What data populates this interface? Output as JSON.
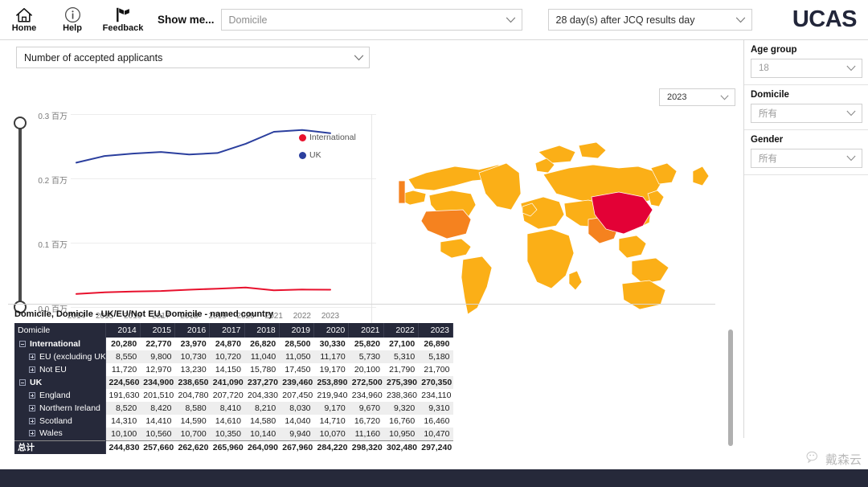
{
  "topbar": {
    "tools": [
      {
        "label": "Home",
        "icon": "home-icon"
      },
      {
        "label": "Help",
        "icon": "info-icon"
      },
      {
        "label": "Feedback",
        "icon": "feedback-flag-icon"
      }
    ],
    "show_me_label": "Show me...",
    "show_me_value": "Domicile",
    "day_selector_value": "28 day(s) after JCQ results day",
    "logo": "UCAS"
  },
  "filters": [
    {
      "title": "Age group",
      "value": "18"
    },
    {
      "title": "Domicile",
      "value": "所有"
    },
    {
      "title": "Gender",
      "value": "所有"
    }
  ],
  "chart_panel": {
    "metric_value": "Number of accepted applicants",
    "year_value": "2023"
  },
  "chart_data": {
    "type": "line",
    "title": "Number of accepted applicants",
    "xlabel": "",
    "ylabel": "",
    "grid": true,
    "legend_position": "right",
    "ylim": [
      0,
      300000
    ],
    "ytick_labels": [
      "0.3 百万",
      "0.2 百万",
      "0.1 百万",
      "0.0 百万"
    ],
    "ytick_values": [
      300000,
      200000,
      100000,
      0
    ],
    "categories": [
      "2014",
      "2015",
      "2016",
      "2017",
      "2018",
      "2019",
      "2020",
      "2021",
      "2022",
      "2023"
    ],
    "series": [
      {
        "name": "UK",
        "color": "#2b3f9e",
        "values": [
          224560,
          234900,
          238650,
          241090,
          237270,
          239460,
          253890,
          272500,
          275390,
          270350
        ]
      },
      {
        "name": "International",
        "color": "#e8112d",
        "values": [
          20280,
          22770,
          23970,
          24870,
          26820,
          28500,
          30330,
          25820,
          27100,
          26890
        ]
      }
    ]
  },
  "map": {
    "type": "choropleth",
    "highlight_country": "China",
    "colors": {
      "high": "#e30136",
      "mid": "#f5821f",
      "base": "#fbaf17"
    }
  },
  "table": {
    "caption": "Domicile, Domicile - UK/EU/Not EU, Domicile - named country",
    "first_column_header": "Domicile",
    "year_headers": [
      "2014",
      "2015",
      "2016",
      "2017",
      "2018",
      "2019",
      "2020",
      "2021",
      "2022",
      "2023"
    ],
    "rows": [
      {
        "label": "International",
        "indent": 0,
        "toggle": "minus",
        "bold": true,
        "band": false,
        "clipped": false,
        "values": [
          "20,280",
          "22,770",
          "23,970",
          "24,870",
          "26,820",
          "28,500",
          "30,330",
          "25,820",
          "27,100",
          "26,890"
        ]
      },
      {
        "label": "EU (excluding UK)",
        "indent": 1,
        "toggle": "plus",
        "bold": false,
        "band": true,
        "clipped": false,
        "values": [
          "8,550",
          "9,800",
          "10,730",
          "10,720",
          "11,040",
          "11,050",
          "11,170",
          "5,730",
          "5,310",
          "5,180"
        ]
      },
      {
        "label": "Not EU",
        "indent": 1,
        "toggle": "plus",
        "bold": false,
        "band": false,
        "clipped": false,
        "values": [
          "11,720",
          "12,970",
          "13,230",
          "14,150",
          "15,780",
          "17,450",
          "19,170",
          "20,100",
          "21,790",
          "21,700"
        ]
      },
      {
        "label": "UK",
        "indent": 0,
        "toggle": "minus",
        "bold": true,
        "band": true,
        "clipped": false,
        "values": [
          "224,560",
          "234,900",
          "238,650",
          "241,090",
          "237,270",
          "239,460",
          "253,890",
          "272,500",
          "275,390",
          "270,350"
        ]
      },
      {
        "label": "England",
        "indent": 1,
        "toggle": "plus",
        "bold": false,
        "band": false,
        "clipped": false,
        "values": [
          "191,630",
          "201,510",
          "204,780",
          "207,720",
          "204,330",
          "207,450",
          "219,940",
          "234,960",
          "238,360",
          "234,110"
        ]
      },
      {
        "label": "Northern Ireland",
        "indent": 1,
        "toggle": "plus",
        "bold": false,
        "band": true,
        "clipped": false,
        "values": [
          "8,520",
          "8,420",
          "8,580",
          "8,410",
          "8,210",
          "8,030",
          "9,170",
          "9,670",
          "9,320",
          "9,310"
        ]
      },
      {
        "label": "Scotland",
        "indent": 1,
        "toggle": "plus",
        "bold": false,
        "band": false,
        "clipped": false,
        "values": [
          "14,310",
          "14,410",
          "14,590",
          "14,610",
          "14,580",
          "14,040",
          "14,710",
          "16,720",
          "16,760",
          "16,460"
        ]
      },
      {
        "label": "Wales",
        "indent": 1,
        "toggle": "plus",
        "bold": false,
        "band": true,
        "clipped": true,
        "values": [
          "10,100",
          "10,560",
          "10,700",
          "10,350",
          "10,140",
          "9,940",
          "10,070",
          "11,160",
          "10,950",
          "10,470"
        ]
      }
    ],
    "total_row": {
      "label": "总计",
      "values": [
        "244,830",
        "257,660",
        "262,620",
        "265,960",
        "264,090",
        "267,960",
        "284,220",
        "298,320",
        "302,480",
        "297,240"
      ]
    }
  },
  "watermark": {
    "text": "戴森云",
    "icon": "wechat-icon"
  }
}
